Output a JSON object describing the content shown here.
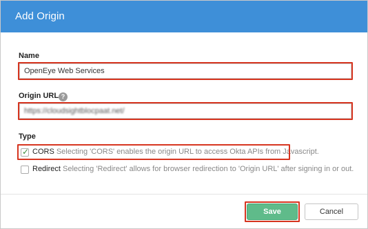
{
  "dialog": {
    "title": "Add Origin"
  },
  "form": {
    "name_label": "Name",
    "name_value": "OpenEye Web Services",
    "origin_label": "Origin URL",
    "origin_help_icon": "?",
    "origin_value": "https://cloudsightblocpaat.net/",
    "type_label": "Type"
  },
  "options": [
    {
      "name": "CORS",
      "desc": "Selecting 'CORS' enables the origin URL to access Okta APIs from Javascript.",
      "checked": true
    },
    {
      "name": "Redirect",
      "desc": "Selecting 'Redirect' allows for browser redirection to 'Origin URL' after signing in or out.",
      "checked": false
    }
  ],
  "footer": {
    "save_label": "Save",
    "cancel_label": "Cancel"
  },
  "colors": {
    "header": "#3e8fd8",
    "highlight": "#d6341f",
    "save": "#5fbb8a"
  },
  "icons": {
    "check": "check-icon",
    "help": "help-icon"
  }
}
